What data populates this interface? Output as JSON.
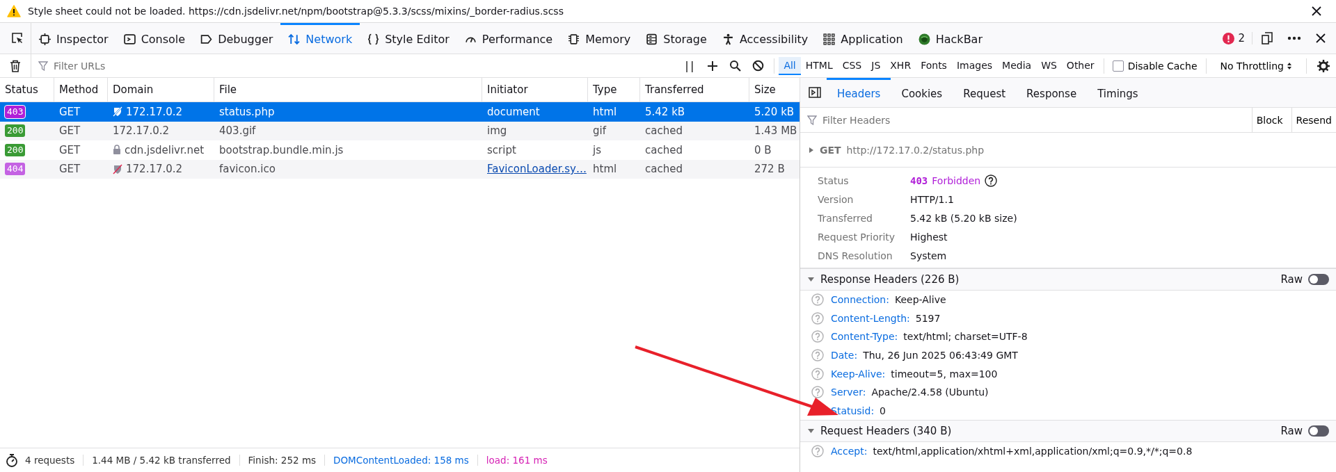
{
  "notification": {
    "text": "Style sheet could not be loaded. https://cdn.jsdelivr.net/npm/bootstrap@5.3.3/scss/mixins/_border-radius.scss"
  },
  "tools": [
    {
      "label": "Inspector",
      "selected": false
    },
    {
      "label": "Console",
      "selected": false
    },
    {
      "label": "Debugger",
      "selected": false
    },
    {
      "label": "Network",
      "selected": true
    },
    {
      "label": "Style Editor",
      "selected": false
    },
    {
      "label": "Performance",
      "selected": false
    },
    {
      "label": "Memory",
      "selected": false
    },
    {
      "label": "Storage",
      "selected": false
    },
    {
      "label": "Accessibility",
      "selected": false
    },
    {
      "label": "Application",
      "selected": false
    },
    {
      "label": "HackBar",
      "selected": false
    }
  ],
  "error_count": "2",
  "filter_bar": {
    "placeholder": "Filter URLs",
    "pause_label": "| |",
    "type_filters": [
      {
        "label": "All",
        "selected": true
      },
      {
        "label": "HTML",
        "selected": false
      },
      {
        "label": "CSS",
        "selected": false
      },
      {
        "label": "JS",
        "selected": false
      },
      {
        "label": "XHR",
        "selected": false
      },
      {
        "label": "Fonts",
        "selected": false
      },
      {
        "label": "Images",
        "selected": false
      },
      {
        "label": "Media",
        "selected": false
      },
      {
        "label": "WS",
        "selected": false
      },
      {
        "label": "Other",
        "selected": false
      }
    ],
    "disable_cache": {
      "label": "Disable Cache",
      "checked": false
    },
    "throttling": "No Throttling"
  },
  "table": {
    "columns": [
      "Status",
      "Method",
      "Domain",
      "File",
      "Initiator",
      "Type",
      "Transferred",
      "Size"
    ],
    "rows": [
      {
        "status": "403",
        "color": "#b01fd8",
        "method": "GET",
        "kind": "insecure",
        "domain": "172.17.0.2",
        "file": "status.php",
        "initiator": "document",
        "initiator_link": false,
        "type": "html",
        "transferred": "5.42 kB",
        "size": "5.20 kB",
        "selected": true
      },
      {
        "status": "200",
        "color": "#3a9b35",
        "method": "GET",
        "kind": "plain",
        "domain": "172.17.0.2",
        "file": "403.gif",
        "initiator": "img",
        "initiator_link": false,
        "type": "gif",
        "transferred": "cached",
        "size": "1.43 MB",
        "selected": false
      },
      {
        "status": "200",
        "color": "#3a9b35",
        "method": "GET",
        "kind": "secure",
        "domain": "cdn.jsdelivr.net",
        "file": "bootstrap.bundle.min.js",
        "initiator": "script",
        "initiator_link": false,
        "type": "js",
        "transferred": "cached",
        "size": "0 B",
        "selected": false
      },
      {
        "status": "404",
        "color": "#c462e3",
        "method": "GET",
        "kind": "blocked",
        "domain": "172.17.0.2",
        "file": "favicon.ico",
        "initiator": "FaviconLoader.sy…",
        "initiator_link": true,
        "type": "html",
        "transferred": "cached",
        "size": "272 B",
        "selected": false
      }
    ]
  },
  "status_bar": [
    {
      "text": "4 requests",
      "kind": "plain"
    },
    {
      "text": "1.44 MB / 5.42 kB transferred",
      "kind": "plain"
    },
    {
      "text": "Finish: 252 ms",
      "kind": "plain"
    },
    {
      "text": "DOMContentLoaded: 158 ms",
      "kind": "dom"
    },
    {
      "text": "load: 161 ms",
      "kind": "load"
    }
  ],
  "details": {
    "tabs": [
      {
        "label": "Headers",
        "selected": true
      },
      {
        "label": "Cookies",
        "selected": false
      },
      {
        "label": "Request",
        "selected": false
      },
      {
        "label": "Response",
        "selected": false
      },
      {
        "label": "Timings",
        "selected": false
      }
    ],
    "filter_placeholder": "Filter Headers",
    "buttons": [
      "Block",
      "Resend"
    ],
    "request_line": {
      "method": "GET",
      "url": "http://172.17.0.2/status.php",
      "expanded": false
    },
    "summary": [
      {
        "label": "Status",
        "kind": "status",
        "code": "403",
        "value": "Forbidden"
      },
      {
        "label": "Version",
        "kind": "text",
        "value": "HTTP/1.1"
      },
      {
        "label": "Transferred",
        "kind": "text",
        "value": "5.42 kB (5.20 kB size)"
      },
      {
        "label": "Request Priority",
        "kind": "text",
        "value": "Highest"
      },
      {
        "label": "DNS Resolution",
        "kind": "text",
        "value": "System"
      }
    ],
    "sections": [
      {
        "title": "Response Headers (226 B)",
        "expanded": true,
        "raw_label": "Raw",
        "raw": false,
        "headers": [
          {
            "name": "Connection:",
            "value": "Keep-Alive",
            "help": true
          },
          {
            "name": "Content-Length:",
            "value": "5197",
            "help": true
          },
          {
            "name": "Content-Type:",
            "value": "text/html; charset=UTF-8",
            "help": true
          },
          {
            "name": "Date:",
            "value": "Thu, 26 Jun 2025 06:43:49 GMT",
            "help": true
          },
          {
            "name": "Keep-Alive:",
            "value": "timeout=5, max=100",
            "help": true
          },
          {
            "name": "Server:",
            "value": "Apache/2.4.58 (Ubuntu)",
            "help": true
          },
          {
            "name": "Statusid:",
            "value": "0",
            "help": false
          }
        ]
      },
      {
        "title": "Request Headers (340 B)",
        "expanded": true,
        "raw_label": "Raw",
        "raw": false,
        "headers": [
          {
            "name": "Accept:",
            "value": "text/html,application/xhtml+xml,application/xml;q=0.9,*/*;q=0.8",
            "help": true
          }
        ]
      }
    ]
  }
}
